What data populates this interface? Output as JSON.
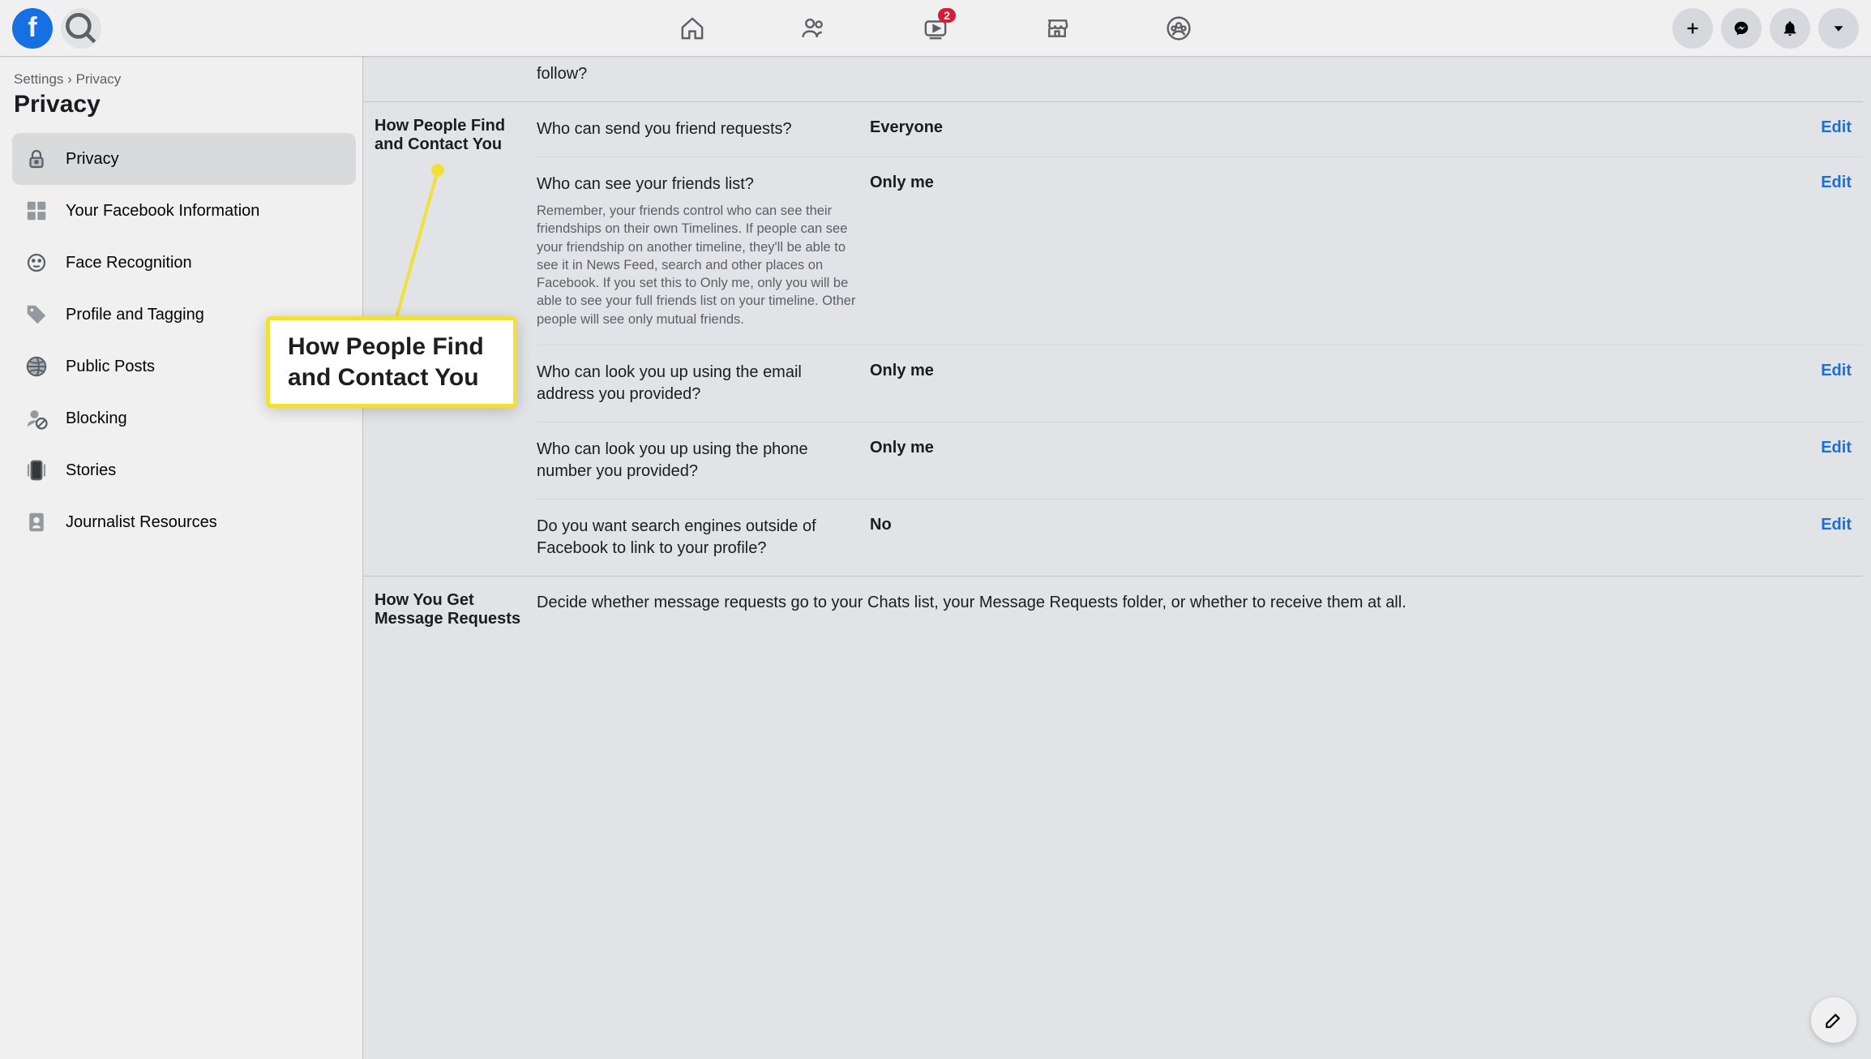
{
  "header": {
    "watch_badge": "2"
  },
  "breadcrumb": {
    "root": "Settings",
    "sep": "›",
    "leaf": "Privacy"
  },
  "page_title": "Privacy",
  "sidebar": {
    "items": [
      {
        "label": "Privacy"
      },
      {
        "label": "Your Facebook Information"
      },
      {
        "label": "Face Recognition"
      },
      {
        "label": "Profile and Tagging"
      },
      {
        "label": "Public Posts"
      },
      {
        "label": "Blocking"
      },
      {
        "label": "Stories"
      },
      {
        "label": "Journalist Resources"
      }
    ]
  },
  "sections": {
    "fragment_top": {
      "partial_text": "follow?"
    },
    "find_contact": {
      "heading": "How People Find and Contact You",
      "settings": [
        {
          "q": "Who can send you friend requests?",
          "value": "Everyone",
          "edit": "Edit"
        },
        {
          "q": "Who can see your friends list?",
          "desc": "Remember, your friends control who can see their friendships on their own Timelines. If people can see your friendship on another timeline, they'll be able to see it in News Feed, search and other places on Facebook. If you set this to Only me, only you will be able to see your full friends list on your timeline. Other people will see only mutual friends.",
          "value": "Only me",
          "edit": "Edit"
        },
        {
          "q": "Who can look you up using the email address you provided?",
          "value": "Only me",
          "edit": "Edit"
        },
        {
          "q": "Who can look you up using the phone number you provided?",
          "value": "Only me",
          "edit": "Edit"
        },
        {
          "q": "Do you want search engines outside of Facebook to link to your profile?",
          "value": "No",
          "edit": "Edit"
        }
      ]
    },
    "message_requests": {
      "heading": "How You Get Message Requests",
      "intro": "Decide whether message requests go to your Chats list, your Message Requests folder, or whether to receive them at all."
    }
  },
  "callout": {
    "text": "How People Find and Contact You"
  }
}
